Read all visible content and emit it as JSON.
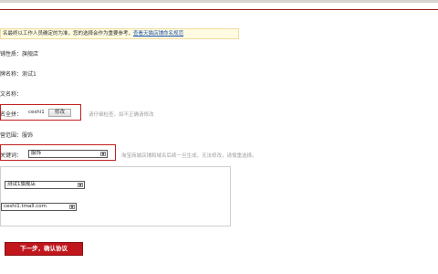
{
  "notice": {
    "text": "名最终以工作人员确定的为准，您的选择会作为重要参考，",
    "link": "查看天猫店铺命名规范"
  },
  "fields": {
    "nature_label": "铺性质：",
    "nature_value": "旗舰店",
    "brand_label": "牌名称：",
    "brand_value": "测试1",
    "en_label": "文名称：",
    "en_value": "",
    "fullname_label": "名全拼：",
    "fullname_value": "ceshi1",
    "modify_label": "修改",
    "fullname_hint": "请仔细检查，如不正确请修改",
    "scope_label": "营范围：",
    "scope_value": "服饰",
    "keyword_label": "关键词：",
    "keyword_value": "服饰",
    "keyword_hint": "淘宝商城店铺和域名后续一旦生成，无法修改，请慎重选择。"
  },
  "preview": {
    "shop_name": "测试1旗舰店",
    "domain": "ceshi1.tmall.com"
  },
  "actions": {
    "next_label": "下一步，确认协议"
  },
  "colors": {
    "accent_red": "#c0161c",
    "link_blue": "#1f56b5"
  }
}
